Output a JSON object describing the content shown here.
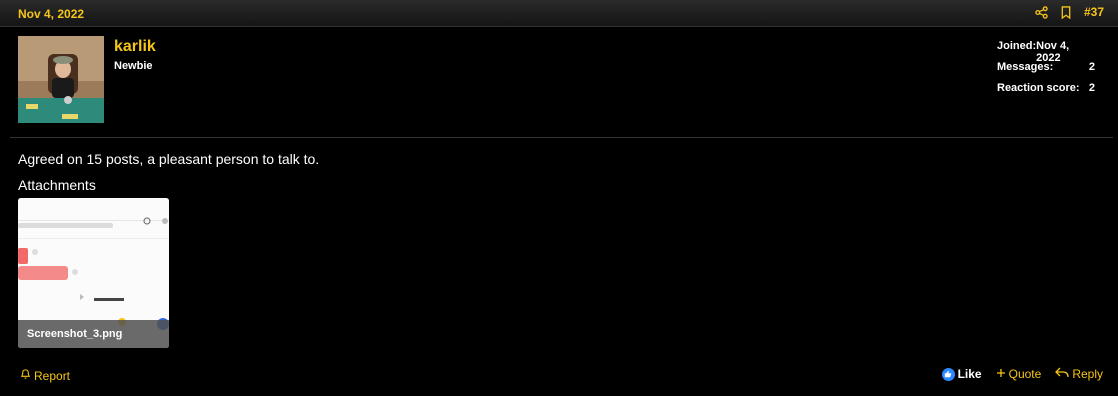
{
  "post": {
    "date": "Nov 4, 2022",
    "number": "#37",
    "message": "Agreed on 15 posts, a pleasant person to talk to.",
    "attachments_label": "Attachments"
  },
  "user": {
    "name": "karlik",
    "title": "Newbie",
    "stats": [
      {
        "label": "Joined:",
        "value": "Nov 4, 2022"
      },
      {
        "label": "Messages:",
        "value": "2"
      },
      {
        "label": "Reaction score:",
        "value": "2"
      }
    ]
  },
  "attachment": {
    "filename": "Screenshot_3.png"
  },
  "actions": {
    "report": "Report",
    "like": "Like",
    "quote": "Quote",
    "reply": "Reply"
  },
  "colors": {
    "accent": "#f5c518",
    "background": "#000000",
    "like_blue": "#2d88ff"
  },
  "icons": [
    "share-icon",
    "bookmark-icon",
    "bell-icon",
    "thumbs-up-icon",
    "plus-icon",
    "reply-arrow-icon"
  ]
}
